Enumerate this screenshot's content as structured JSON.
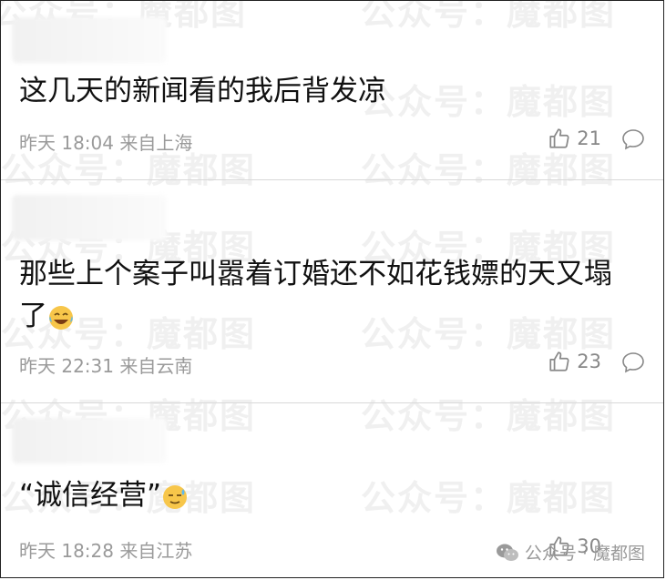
{
  "watermark": "公众号：魔都图",
  "comments": [
    {
      "text": "这几天的新闻看的我后背发凉",
      "meta": "昨天 18:04 来自上海",
      "likes": "21"
    },
    {
      "text_line1": "那些上个案子叫嚣着订婚还不如花钱嫖的天又塌",
      "text_line2": "了",
      "emoji": "laugh-cry",
      "meta": "昨天 22:31 来自云南",
      "likes": "23"
    },
    {
      "text": "“诚信经营”",
      "emoji": "sweat-smile",
      "meta": "昨天 18:28 来自江苏",
      "likes": "30"
    }
  ],
  "badge": {
    "label": "公众号 · 魔都图",
    "icon": "wechat-icon"
  },
  "colors": {
    "text": "#111111",
    "meta": "#9a9a9a",
    "separator": "#d8d8d8"
  }
}
